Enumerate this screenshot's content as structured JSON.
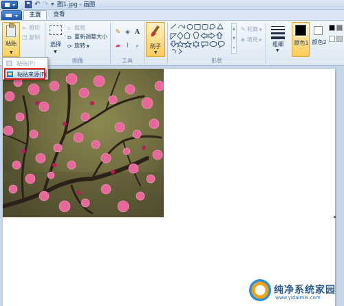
{
  "window": {
    "title": "图1.jpg - 画图"
  },
  "tabs": [
    {
      "label": "主页",
      "active": true
    },
    {
      "label": "查看",
      "active": false
    }
  ],
  "clipboard": {
    "paste_label": "粘贴",
    "cut_label": "剪切",
    "copy_label": "复制"
  },
  "image_group": {
    "label": "图像",
    "select_label": "选择",
    "crop_label": "裁剪",
    "resize_label": "重新调整大小",
    "rotate_label": "旋转"
  },
  "tools_group": {
    "label": "工具"
  },
  "brushes": {
    "label": "刷子"
  },
  "shapes_group": {
    "label": "形状",
    "outline_label": "轮廓",
    "fill_label": "填充"
  },
  "size": {
    "label": "粗细"
  },
  "colors": {
    "color1_label": "颜色1",
    "color2_label": "颜色2",
    "color1_value": "#000000",
    "color2_value": "#ffffff",
    "palette": [
      "#000000",
      "#7f7f7f",
      "#ffffff",
      "#c3c3c3"
    ]
  },
  "paste_menu": {
    "items": [
      {
        "label": "粘贴(P)",
        "enabled": false
      },
      {
        "label": "粘贴来源(F)",
        "enabled": true,
        "highlighted": true
      }
    ]
  },
  "watermark": {
    "title": "纯净系统家园",
    "url": "www.yidaimei.com"
  }
}
